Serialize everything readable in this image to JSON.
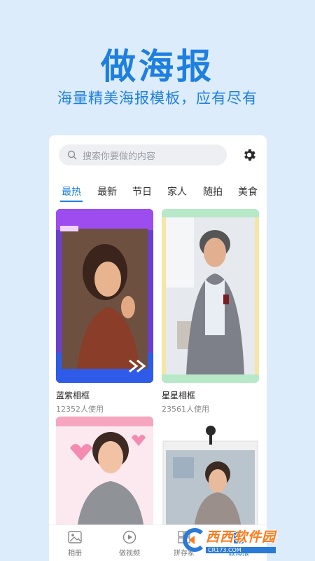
{
  "hero": {
    "title": "做海报",
    "subtitle": "海量精美海报模板，应有尽有"
  },
  "search": {
    "placeholder": "搜索你要做的内容",
    "icon": "search-icon"
  },
  "settings_icon": "gear-icon",
  "tabs": [
    {
      "label": "最热",
      "active": true
    },
    {
      "label": "最新",
      "active": false
    },
    {
      "label": "节日",
      "active": false
    },
    {
      "label": "家人",
      "active": false
    },
    {
      "label": "随拍",
      "active": false
    },
    {
      "label": "美食",
      "active": false
    }
  ],
  "cards": [
    {
      "title": "蓝紫相框",
      "uses": "12352人使用"
    },
    {
      "title": "星星相框",
      "uses": "23561人使用"
    },
    {
      "title": "",
      "uses": ""
    },
    {
      "title": "",
      "uses": ""
    }
  ],
  "bottom_nav": [
    {
      "label": "相册",
      "icon": "image-icon",
      "active": false
    },
    {
      "label": "做视频",
      "icon": "play-icon",
      "active": false
    },
    {
      "label": "拼存家",
      "icon": "grid-icon",
      "active": false
    },
    {
      "label": "做海报",
      "icon": "poster-icon",
      "active": true
    }
  ],
  "watermark": {
    "text": "西西软件园",
    "url": "CR173.COM"
  },
  "colors": {
    "accent": "#1e7fe0",
    "background": "#dcecfb"
  }
}
